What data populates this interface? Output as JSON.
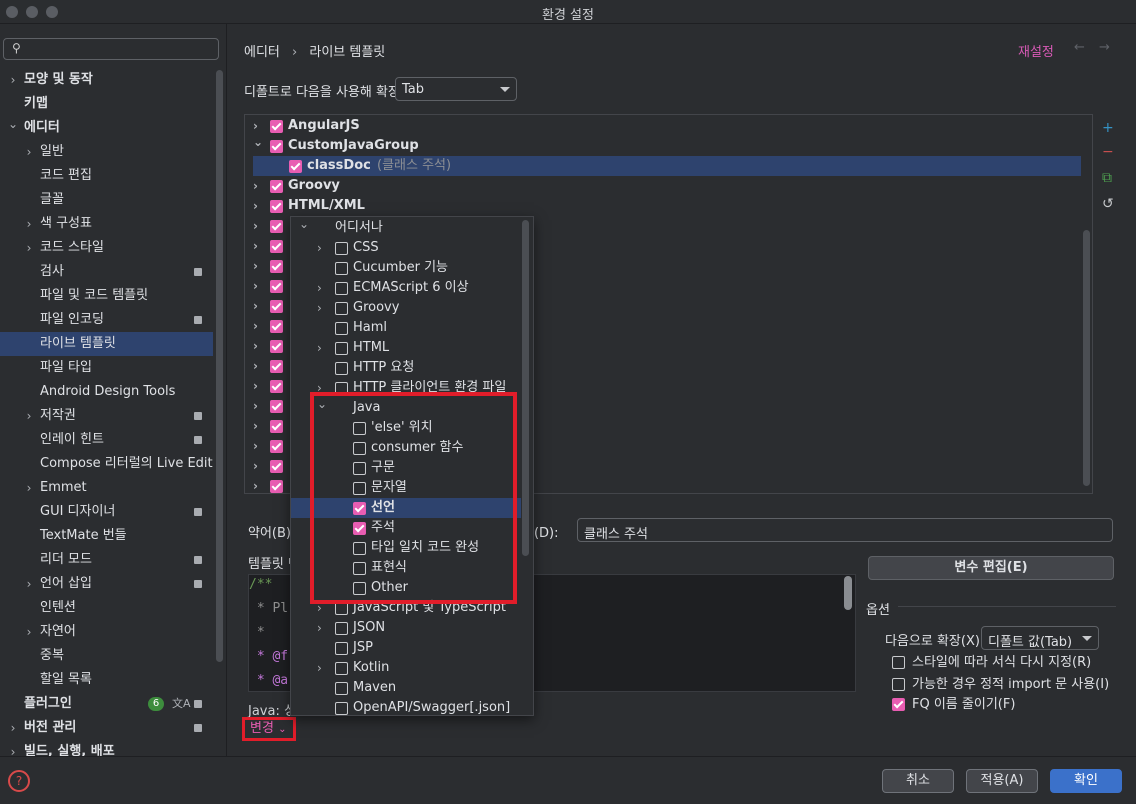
{
  "window": {
    "title": "환경 설정"
  },
  "sidebar": {
    "search_placeholder": "",
    "items": [
      {
        "label": "모양 및 동작",
        "level": 0,
        "expander": "collapsed",
        "lock": false
      },
      {
        "label": "키맵",
        "level": 0,
        "expander": "none",
        "lock": false
      },
      {
        "label": "에디터",
        "level": 0,
        "expander": "expanded",
        "lock": false
      },
      {
        "label": "일반",
        "level": 1,
        "expander": "collapsed",
        "lock": false
      },
      {
        "label": "코드 편집",
        "level": 1,
        "expander": "none",
        "lock": false
      },
      {
        "label": "글꼴",
        "level": 1,
        "expander": "none",
        "lock": false
      },
      {
        "label": "색 구성표",
        "level": 1,
        "expander": "collapsed",
        "lock": false
      },
      {
        "label": "코드 스타일",
        "level": 1,
        "expander": "collapsed",
        "lock": false
      },
      {
        "label": "검사",
        "level": 1,
        "expander": "none",
        "lock": true
      },
      {
        "label": "파일 및 코드 템플릿",
        "level": 1,
        "expander": "none",
        "lock": false
      },
      {
        "label": "파일 인코딩",
        "level": 1,
        "expander": "none",
        "lock": true
      },
      {
        "label": "라이브 템플릿",
        "level": 1,
        "expander": "none",
        "lock": false,
        "selected": true
      },
      {
        "label": "파일 타입",
        "level": 1,
        "expander": "none",
        "lock": false
      },
      {
        "label": "Android Design Tools",
        "level": 1,
        "expander": "none",
        "lock": false
      },
      {
        "label": "저작권",
        "level": 1,
        "expander": "collapsed",
        "lock": true
      },
      {
        "label": "인레이 힌트",
        "level": 1,
        "expander": "none",
        "lock": true
      },
      {
        "label": "Compose 리터럴의 Live Edit",
        "level": 1,
        "expander": "none",
        "lock": false
      },
      {
        "label": "Emmet",
        "level": 1,
        "expander": "collapsed",
        "lock": false
      },
      {
        "label": "GUI 디자이너",
        "level": 1,
        "expander": "none",
        "lock": true
      },
      {
        "label": "TextMate 번들",
        "level": 1,
        "expander": "none",
        "lock": false
      },
      {
        "label": "리더 모드",
        "level": 1,
        "expander": "none",
        "lock": true
      },
      {
        "label": "언어 삽입",
        "level": 1,
        "expander": "collapsed",
        "lock": true
      },
      {
        "label": "인텐션",
        "level": 1,
        "expander": "none",
        "lock": false
      },
      {
        "label": "자연어",
        "level": 1,
        "expander": "collapsed",
        "lock": false
      },
      {
        "label": "중복",
        "level": 1,
        "expander": "none",
        "lock": false
      },
      {
        "label": "할일 목록",
        "level": 1,
        "expander": "none",
        "lock": false
      },
      {
        "label": "플러그인",
        "level": 0,
        "expander": "none",
        "lock": true,
        "badge": "6"
      },
      {
        "label": "버전 관리",
        "level": 0,
        "expander": "collapsed",
        "lock": true
      },
      {
        "label": "빌드, 실행, 배포",
        "level": 0,
        "expander": "collapsed",
        "lock": false
      }
    ]
  },
  "header": {
    "breadcrumb_parent": "에디터",
    "breadcrumb_sep": "›",
    "breadcrumb_current": "라이브 템플릿",
    "reset_label": "재설정",
    "back_icon": "←",
    "forward_icon": "→"
  },
  "expand_row": {
    "label": "디폴트로 다음을 사용해 확장",
    "value": "Tab"
  },
  "template_tree": [
    {
      "label": "AngularJS",
      "expander": "collapsed",
      "checked": true,
      "indent": 0
    },
    {
      "label": "CustomJavaGroup",
      "expander": "expanded",
      "checked": true,
      "indent": 0
    },
    {
      "label": "classDoc",
      "desc": "(클래스 주석)",
      "expander": "none",
      "checked": true,
      "indent": 1,
      "selected": true
    },
    {
      "label": "Groovy",
      "expander": "collapsed",
      "checked": true,
      "indent": 0
    },
    {
      "label": "HTML/XML",
      "expander": "collapsed",
      "checked": true,
      "indent": 0
    },
    {
      "label": "",
      "expander": "collapsed",
      "checked": true,
      "indent": 0
    },
    {
      "label": "",
      "expander": "collapsed",
      "checked": true,
      "indent": 0
    },
    {
      "label": "",
      "expander": "collapsed",
      "checked": true,
      "indent": 0
    },
    {
      "label": "",
      "expander": "collapsed",
      "checked": true,
      "indent": 0
    },
    {
      "label": "",
      "expander": "collapsed",
      "checked": true,
      "indent": 0
    },
    {
      "label": "",
      "expander": "collapsed",
      "checked": true,
      "indent": 0
    },
    {
      "label": "",
      "expander": "collapsed",
      "checked": true,
      "indent": 0
    },
    {
      "label": "",
      "expander": "collapsed",
      "checked": true,
      "indent": 0
    },
    {
      "label": "",
      "expander": "collapsed",
      "checked": true,
      "indent": 0
    },
    {
      "label": "",
      "expander": "collapsed",
      "checked": true,
      "indent": 0
    },
    {
      "label": "",
      "expander": "collapsed",
      "checked": true,
      "indent": 0
    },
    {
      "label": "",
      "expander": "collapsed",
      "checked": true,
      "indent": 0
    },
    {
      "label": "",
      "expander": "collapsed",
      "checked": true,
      "indent": 0
    },
    {
      "label": "",
      "expander": "collapsed",
      "checked": true,
      "indent": 0
    }
  ],
  "side_tools": [
    "add-icon",
    "remove-icon",
    "copy-icon",
    "restore-icon"
  ],
  "details": {
    "abbrev_label": "약어(B)",
    "desc_label": "경(D):",
    "desc_value": "클래스 주석",
    "template_label": "템플릿 텍",
    "code_lines": [
      "/**",
      " * Pl",
      " *",
      " * @f",
      " * @a"
    ],
    "edit_vars_label": "변수 편집(E)",
    "java_label": "Java: 싱",
    "change_label": "변경"
  },
  "options": {
    "title": "옵션",
    "expand_label": "다음으로 확장(X)",
    "expand_value": "디폴트 값(Tab)",
    "reformat_label": "스타일에 따라 서식 다시 지정(R)",
    "reformat_checked": false,
    "static_import_label": "가능한 경우 정적 import 문 사용(I)",
    "static_import_checked": false,
    "shorten_fq_label": "FQ 이름 줄이기(F)",
    "shorten_fq_checked": true
  },
  "context_popup": {
    "items": [
      {
        "label": "어디서나",
        "state": "partial",
        "expander": "expanded",
        "indent": 0
      },
      {
        "label": "CSS",
        "state": "off",
        "expander": "collapsed",
        "indent": 1
      },
      {
        "label": "Cucumber 기능",
        "state": "off",
        "expander": "none",
        "indent": 1
      },
      {
        "label": "ECMAScript 6 이상",
        "state": "off",
        "expander": "collapsed",
        "indent": 1
      },
      {
        "label": "Groovy",
        "state": "off",
        "expander": "collapsed",
        "indent": 1
      },
      {
        "label": "Haml",
        "state": "off",
        "expander": "none",
        "indent": 1
      },
      {
        "label": "HTML",
        "state": "off",
        "expander": "collapsed",
        "indent": 1
      },
      {
        "label": "HTTP 요청",
        "state": "off",
        "expander": "none",
        "indent": 1
      },
      {
        "label": "HTTP 클라이언트 환경 파일",
        "state": "off",
        "expander": "collapsed",
        "indent": 1
      },
      {
        "label": "Java",
        "state": "partial",
        "expander": "expanded",
        "indent": 1
      },
      {
        "label": "'else' 위치",
        "state": "off",
        "expander": "none",
        "indent": 2
      },
      {
        "label": "consumer 함수",
        "state": "off",
        "expander": "none",
        "indent": 2
      },
      {
        "label": "구문",
        "state": "off",
        "expander": "none",
        "indent": 2
      },
      {
        "label": "문자열",
        "state": "off",
        "expander": "none",
        "indent": 2
      },
      {
        "label": "선언",
        "state": "on",
        "expander": "none",
        "indent": 2,
        "selected": true
      },
      {
        "label": "주석",
        "state": "on",
        "expander": "none",
        "indent": 2
      },
      {
        "label": "타입 일치 코드 완성",
        "state": "off",
        "expander": "none",
        "indent": 2
      },
      {
        "label": "표현식",
        "state": "off",
        "expander": "none",
        "indent": 2
      },
      {
        "label": "Other",
        "state": "off",
        "expander": "none",
        "indent": 2
      },
      {
        "label": "JavaScript 및 TypeScript",
        "state": "off",
        "expander": "collapsed",
        "indent": 1
      },
      {
        "label": "JSON",
        "state": "off",
        "expander": "collapsed",
        "indent": 1
      },
      {
        "label": "JSP",
        "state": "off",
        "expander": "none",
        "indent": 1
      },
      {
        "label": "Kotlin",
        "state": "off",
        "expander": "collapsed",
        "indent": 1
      },
      {
        "label": "Maven",
        "state": "off",
        "expander": "none",
        "indent": 1
      },
      {
        "label": "OpenAPI/Swagger[.json]",
        "state": "off",
        "expander": "none",
        "indent": 1
      }
    ]
  },
  "footer": {
    "help_icon": "?",
    "cancel_label": "취소",
    "apply_label": "적용(A)",
    "ok_label": "확인"
  },
  "colors": {
    "accent": "#e85db2",
    "selection": "#2e436e",
    "highlight_box": "#e11d2a",
    "primary_button": "#3b71ca"
  }
}
